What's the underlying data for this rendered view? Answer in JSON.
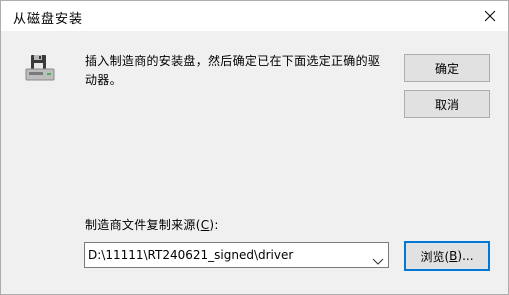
{
  "window": {
    "title": "从磁盘安装",
    "close_glyph": "✕"
  },
  "icons": {
    "disk": "floppy-disk-drive-icon",
    "close": "close-icon",
    "dropdown": "chevron-down-icon"
  },
  "message": {
    "text": "插入制造商的安装盘，然后确定已在下面选定正确的驱动器。"
  },
  "buttons": {
    "ok_label": "确定",
    "cancel_label": "取消",
    "browse_label_prefix": "浏览(",
    "browse_label_key": "B",
    "browse_label_suffix": ")..."
  },
  "source": {
    "label_prefix": "制造商文件复制来源(",
    "label_key": "C",
    "label_suffix": "):",
    "value": "D:\\11111\\RT240621_signed\\driver"
  },
  "colors": {
    "focus_border": "#0078d7",
    "button_bg": "#e1e1e1",
    "dialog_bg": "#f0f0f0"
  }
}
